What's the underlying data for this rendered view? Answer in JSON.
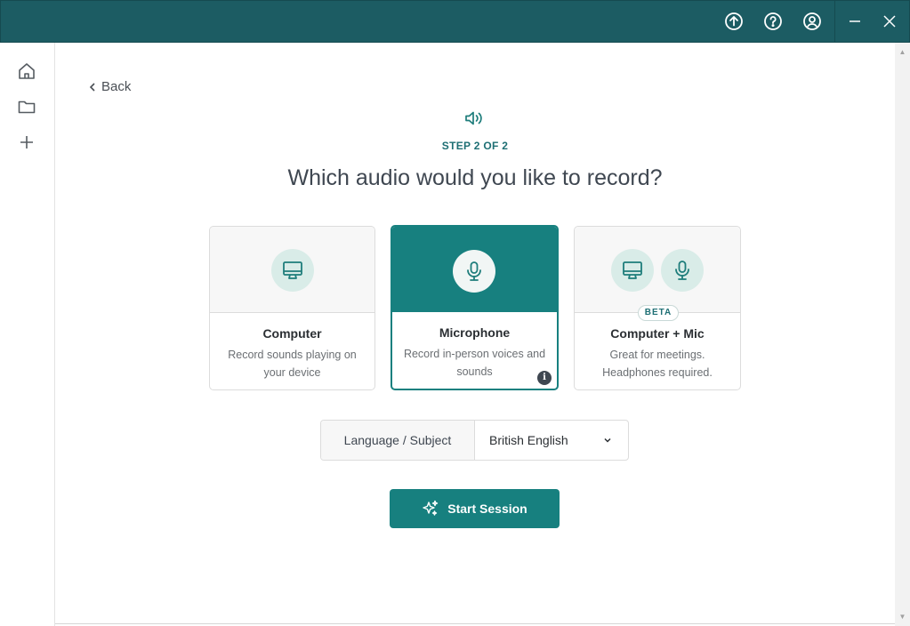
{
  "titlebar": {
    "icons": [
      "upload-icon",
      "help-icon",
      "account-icon",
      "minimize-icon",
      "close-icon"
    ],
    "color": "#1c5c63"
  },
  "sidebar": {
    "items": [
      "home-icon",
      "folder-icon",
      "plus-icon"
    ]
  },
  "nav": {
    "back_label": "Back"
  },
  "step": {
    "label": "STEP 2 OF 2"
  },
  "heading": "Which audio would you like to record?",
  "options": [
    {
      "title": "Computer",
      "description": "Record sounds playing on your device",
      "icon": "monitor-icon",
      "selected": false
    },
    {
      "title": "Microphone",
      "description": "Record in-person voices and sounds",
      "icon": "microphone-icon",
      "selected": true,
      "info_icon": "i"
    },
    {
      "title": "Computer + Mic",
      "description": "Great for meetings. Headphones required.",
      "badge": "BETA",
      "icons": [
        "monitor-icon",
        "microphone-icon"
      ],
      "selected": false
    }
  ],
  "language": {
    "label": "Language / Subject",
    "value": "British English"
  },
  "start_button": {
    "label": "Start Session",
    "color": "#17807f"
  }
}
